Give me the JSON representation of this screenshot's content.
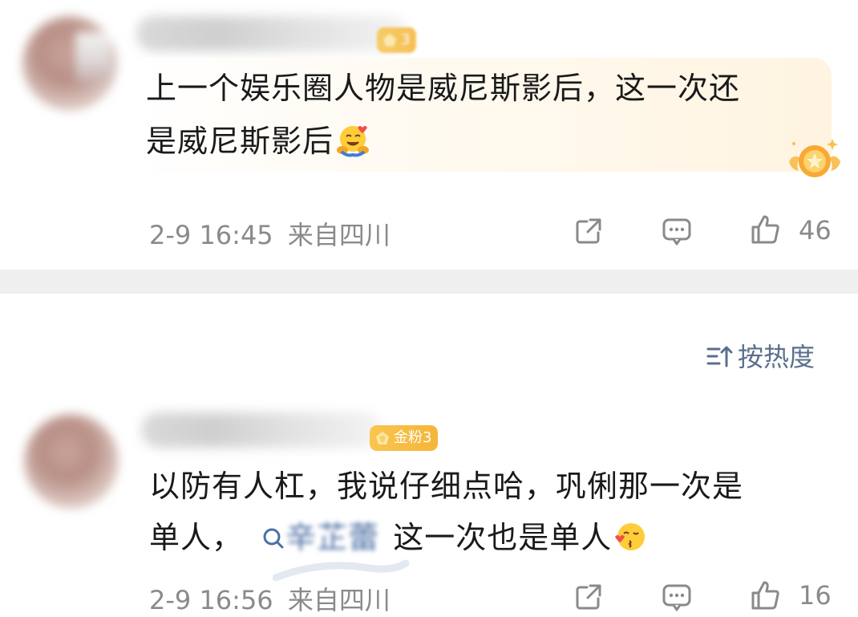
{
  "comments": [
    {
      "badge_label": "3",
      "text_line1": "上一个娱乐圈人物是威尼斯影后，这一次还",
      "text_line2": "是威尼斯影后",
      "emoji": "hugging-face-emoji",
      "time": "2-9 16:45",
      "location": "来自四川",
      "like_count": "46"
    },
    {
      "badge_label": "金粉3",
      "text_line1": "以防有人杠，我说仔细点哈，巩俐那一次是",
      "text_line2_before": "单人，",
      "mention_icon": "search-icon",
      "mention_text": "辛芷蕾",
      "text_line2_after": "这一次也是单人",
      "emoji": "kissing-face-emoji",
      "time": "2-9 16:56",
      "location": "来自四川",
      "like_count": "16"
    }
  ],
  "sort": {
    "label": "按热度",
    "icon": "sort-icon"
  },
  "colors": {
    "badge": "#f5b53a",
    "meta_text": "#8a8a8a",
    "sort_text": "#5a6f8c",
    "mention": "#4d6fa6",
    "divider": "#efefef"
  }
}
